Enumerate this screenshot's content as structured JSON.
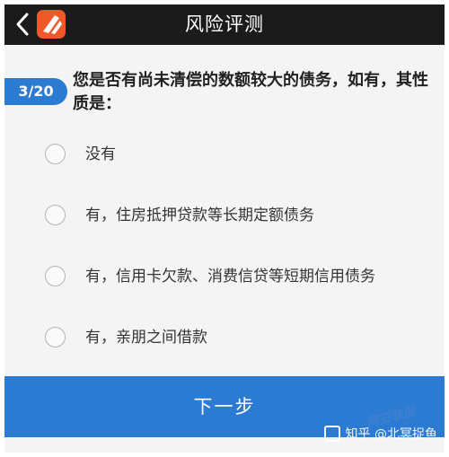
{
  "header": {
    "title": "风险评测"
  },
  "question": {
    "progress": "3/20",
    "text": "您是否有尚未清偿的数额较大的债务，如有，其性质是："
  },
  "options": [
    {
      "label": "没有"
    },
    {
      "label": "有，住房抵押贷款等长期定额债务"
    },
    {
      "label": "有，信用卡欠款、消费信贷等短期信用债务"
    },
    {
      "label": "有，亲朋之间借款"
    }
  ],
  "footer": {
    "next_label": "下一步"
  },
  "watermark": {
    "text": "知乎 @北冥捉鱼",
    "logo_text": "网贷联盟"
  },
  "colors": {
    "accent": "#2c7bd3",
    "header_bg": "#1b1b1b",
    "logo": "#f0582a"
  }
}
